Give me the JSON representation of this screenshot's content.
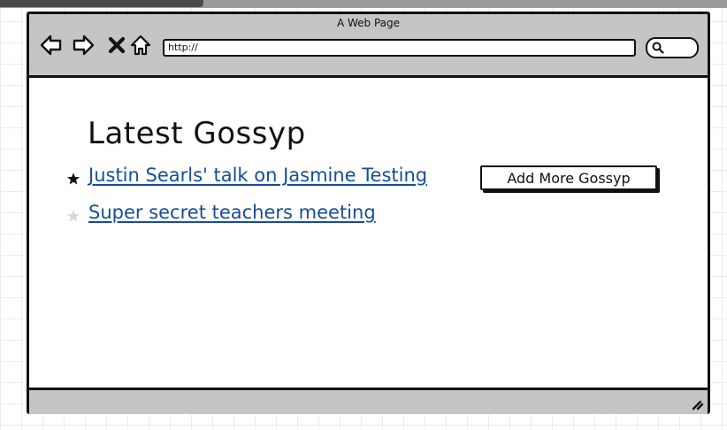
{
  "window": {
    "title": "A Web Page"
  },
  "toolbar": {
    "icons": [
      "back-arrow-icon",
      "forward-arrow-icon",
      "close-icon",
      "home-icon",
      "search-icon"
    ],
    "url": "http://"
  },
  "page": {
    "title": "Latest Gossyp",
    "items": [
      {
        "label": "Justin Searls' talk on Jasmine Testing",
        "starred": true
      },
      {
        "label": "Super secret teachers meeting",
        "starred": false
      }
    ],
    "add_button_label": "Add More Gossyp"
  },
  "colors": {
    "link": "#164e96",
    "chrome": "#c5c5c5",
    "star_filled": "#111111",
    "star_empty": "#d8d8d8"
  }
}
